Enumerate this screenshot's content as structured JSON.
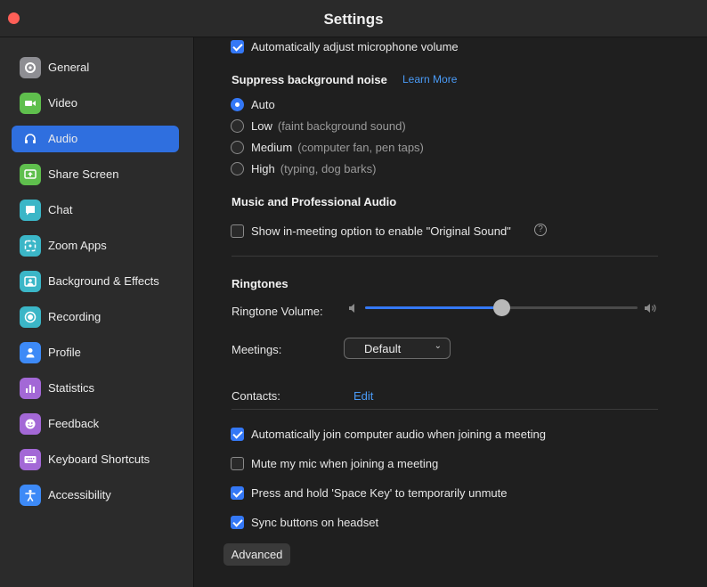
{
  "window": {
    "title": "Settings"
  },
  "sidebar": {
    "items": [
      {
        "label": "General",
        "icon": "gear-icon",
        "color": "#8e8e93",
        "active": false
      },
      {
        "label": "Video",
        "icon": "video-camera-icon",
        "color": "#5fbf4d",
        "active": false
      },
      {
        "label": "Audio",
        "icon": "headphones-icon",
        "color": "#2f6fdf",
        "active": true
      },
      {
        "label": "Share Screen",
        "icon": "share-screen-icon",
        "color": "#5fbf4d",
        "active": false
      },
      {
        "label": "Chat",
        "icon": "chat-bubble-icon",
        "color": "#3bb6c7",
        "active": false
      },
      {
        "label": "Zoom Apps",
        "icon": "zoom-apps-icon",
        "color": "#3bb6c7",
        "active": false
      },
      {
        "label": "Background & Effects",
        "icon": "person-background-icon",
        "color": "#3bb6c7",
        "active": false
      },
      {
        "label": "Recording",
        "icon": "record-icon",
        "color": "#3bb6c7",
        "active": false
      },
      {
        "label": "Profile",
        "icon": "person-icon",
        "color": "#3d8af7",
        "active": false
      },
      {
        "label": "Statistics",
        "icon": "bar-chart-icon",
        "color": "#a368d6",
        "active": false
      },
      {
        "label": "Feedback",
        "icon": "smiley-icon",
        "color": "#a368d6",
        "active": false
      },
      {
        "label": "Keyboard Shortcuts",
        "icon": "keyboard-icon",
        "color": "#a368d6",
        "active": false
      },
      {
        "label": "Accessibility",
        "icon": "accessibility-icon",
        "color": "#3d8af7",
        "active": false
      }
    ]
  },
  "audio": {
    "auto_adjust_label": "Automatically adjust microphone volume",
    "auto_adjust_checked": true,
    "suppress_heading": "Suppress background noise",
    "learn_more": "Learn More",
    "noise_options": [
      {
        "label": "Auto",
        "hint": "",
        "selected": true
      },
      {
        "label": "Low",
        "hint": "(faint background sound)",
        "selected": false
      },
      {
        "label": "Medium",
        "hint": "(computer fan, pen taps)",
        "selected": false
      },
      {
        "label": "High",
        "hint": "(typing, dog barks)",
        "selected": false
      }
    ],
    "music_heading": "Music and Professional Audio",
    "original_sound_label": "Show in-meeting option to enable \"Original Sound\"",
    "original_sound_checked": false,
    "help_glyph": "?",
    "ringtones_heading": "Ringtones",
    "ringtone_volume_label": "Ringtone Volume:",
    "ringtone_volume_fraction": 0.5,
    "meetings_label": "Meetings:",
    "meetings_value": "Default",
    "contacts_label": "Contacts:",
    "contacts_edit": "Edit",
    "options": [
      {
        "label": "Automatically join computer audio when joining a meeting",
        "checked": true
      },
      {
        "label": "Mute my mic when joining a meeting",
        "checked": false
      },
      {
        "label": "Press and hold 'Space Key' to temporarily unmute",
        "checked": true
      },
      {
        "label": "Sync buttons on headset",
        "checked": true
      }
    ],
    "advanced_button": "Advanced"
  },
  "colors": {
    "accent": "#3478f6",
    "link": "#4a9bf7",
    "close": "#fe5f57"
  }
}
